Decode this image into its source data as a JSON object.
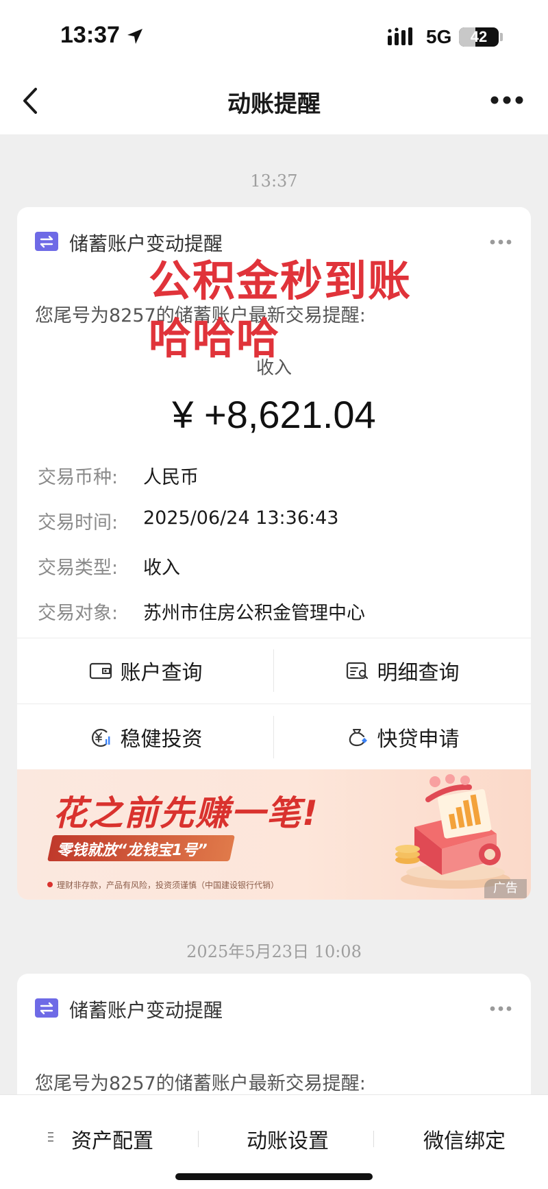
{
  "status_bar": {
    "time": "13:37",
    "network": "5G",
    "battery": "42",
    "battery_level": 0.42
  },
  "nav": {
    "title": "动账提醒"
  },
  "messages": [
    {
      "time": "13:37",
      "card_title": "储蓄账户变动提醒",
      "intro": "您尾号为8257的储蓄账户最新交易提醒:",
      "overlay_line1": "公积金秒到账",
      "overlay_line2": "哈哈哈",
      "amount_label": "收入",
      "amount": "¥ +8,621.04",
      "details": [
        {
          "label": "交易币种:",
          "value": "人民币"
        },
        {
          "label": "交易时间:",
          "value": "2025/06/24 13:36:43"
        },
        {
          "label": "交易类型:",
          "value": "收入"
        },
        {
          "label": "交易对象:",
          "value": "苏州市住房公积金管理中心"
        }
      ],
      "actions": [
        "账户查询",
        "明细查询",
        "稳健投资",
        "快贷申请"
      ],
      "banner": {
        "title": "花之前先赚一笔!",
        "tag": "零钱就放“龙钱宝1号”",
        "note": "理财非存款，产品有风险，投资须谨慎（中国建设银行代销）",
        "ad": "广告"
      }
    },
    {
      "time": "2025年5月23日 10:08",
      "card_title": "储蓄账户变动提醒",
      "intro": "您尾号为8257的储蓄账户最新交易提醒:"
    }
  ],
  "bottom_bar": [
    "资产配置",
    "动账设置",
    "微信绑定"
  ],
  "colors": {
    "accent_red": "#e0333a",
    "icon_purple": "#6e6ae6"
  }
}
